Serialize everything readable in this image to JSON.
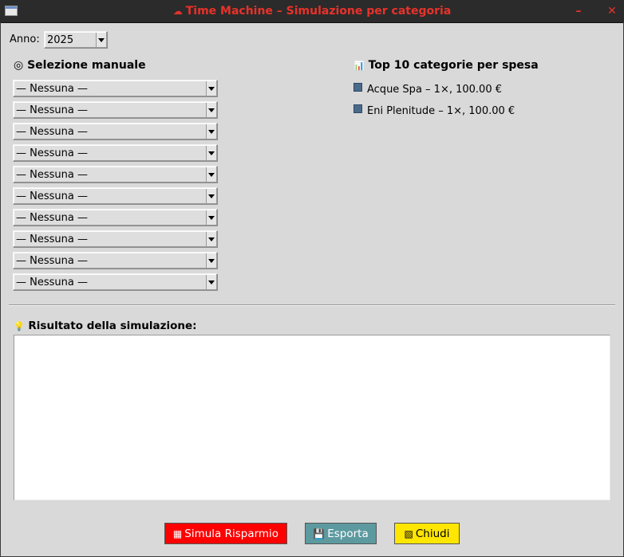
{
  "window": {
    "title": "Time Machine – Simulazione per categoria",
    "title_icon": "☁",
    "minimize": "–",
    "close": "✕"
  },
  "year": {
    "label": "Anno:",
    "selected": "2025"
  },
  "manual": {
    "title": "Selezione manuale",
    "icon": "◎",
    "selections": [
      "— Nessuna —",
      "— Nessuna —",
      "— Nessuna —",
      "— Nessuna —",
      "— Nessuna —",
      "— Nessuna —",
      "— Nessuna —",
      "— Nessuna —",
      "— Nessuna —",
      "— Nessuna —"
    ]
  },
  "top": {
    "title": "Top 10 categorie per spesa",
    "icon": "📊",
    "items": [
      "Acque Spa – 1×, 100.00 €",
      "Eni Plenitude – 1×, 100.00 €"
    ]
  },
  "result": {
    "title": "Risultato della simulazione:",
    "icon": "💡",
    "text": ""
  },
  "buttons": {
    "simulate": {
      "label": "Simula Risparmio",
      "icon": "▦"
    },
    "export": {
      "label": "Esporta",
      "icon": "💾"
    },
    "close": {
      "label": "Chiudi",
      "icon": "▧"
    }
  },
  "colors": {
    "title_text": "#e8322a",
    "simulate_bg": "#ff0000",
    "export_bg": "#5d9aa0",
    "close_bg": "#ffe600",
    "bullet": "#4a6a8a"
  }
}
